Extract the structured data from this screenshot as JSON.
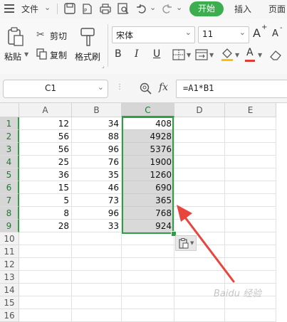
{
  "menubar": {
    "file_label": "文件",
    "tab_start": "开始",
    "tab_insert": "插入",
    "tab_page": "页面"
  },
  "ribbon": {
    "paste": "粘贴",
    "cut": "剪切",
    "copy": "复制",
    "format_painter": "格式刷",
    "font_name": "宋体",
    "font_size": "11",
    "bold": "B",
    "italic": "I",
    "underline": "U",
    "grow": "A",
    "shrink": "A",
    "font_color_letter": "A",
    "accent_underline": "#e03c31"
  },
  "formula_bar": {
    "name_box": "C1",
    "fx_label": "fx",
    "formula": "=A1*B1"
  },
  "sheet": {
    "columns": [
      "A",
      "B",
      "C",
      "D",
      "E"
    ],
    "row_numbers": [
      "1",
      "2",
      "3",
      "4",
      "5",
      "6",
      "7",
      "8",
      "9",
      "10",
      "11",
      "12",
      "13",
      "14",
      "15",
      "16"
    ],
    "A": [
      "12",
      "56",
      "56",
      "25",
      "36",
      "15",
      "5",
      "8",
      "28"
    ],
    "B": [
      "34",
      "88",
      "96",
      "76",
      "35",
      "46",
      "73",
      "96",
      "33"
    ],
    "C": [
      "408",
      "4928",
      "5376",
      "1900",
      "1260",
      "690",
      "365",
      "768",
      "924"
    ],
    "selection_color": "#2f9e44"
  },
  "watermark": "Baidu 经验"
}
